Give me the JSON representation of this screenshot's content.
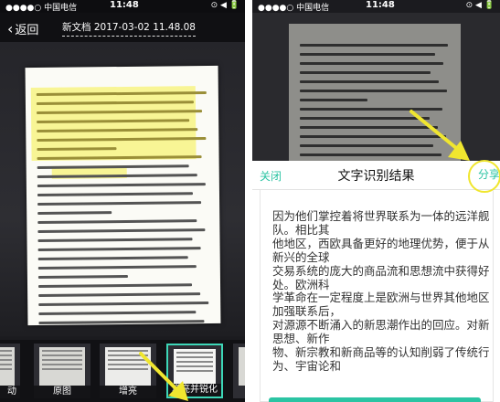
{
  "left": {
    "status": {
      "carrier": "●●●●○ 中国电信",
      "time": "11:48",
      "icons": "⊙ ◀ 🔋"
    },
    "nav": {
      "back_label": "返回",
      "doc_title": "新文档 2017-03-02 11.48.08"
    },
    "filters": [
      {
        "label": "原图"
      },
      {
        "label": "增亮"
      },
      {
        "label": "增亮并锐化"
      }
    ],
    "partial_filter_label": "动"
  },
  "right": {
    "status": {
      "carrier": "●●●●○ 中国电信",
      "time": "11:48",
      "icons": "⊙ ◀ 🔋"
    },
    "sheet": {
      "close_label": "关闭",
      "title": "文字识别结果",
      "share_label": "分享"
    },
    "result_text": "因为他们掌控着将世界联系为一体的远洋舰队。相比其\n他地区，西欧具备更好的地理优势，便于从新兴的全球\n交易系统的庞大的商品流和思想流中获得好处。欧洲科\n学革命在一定程度上是欧洲与世界其他地区加强联系后，\n对源源不断涌入的新思潮作出的回应。对新思想、新作\n物、新宗教和新商品等的认知削弱了传统行为、宇宙论和"
  },
  "colors": {
    "accent": "#2bc4a3",
    "highlight": "#f0e62f"
  }
}
